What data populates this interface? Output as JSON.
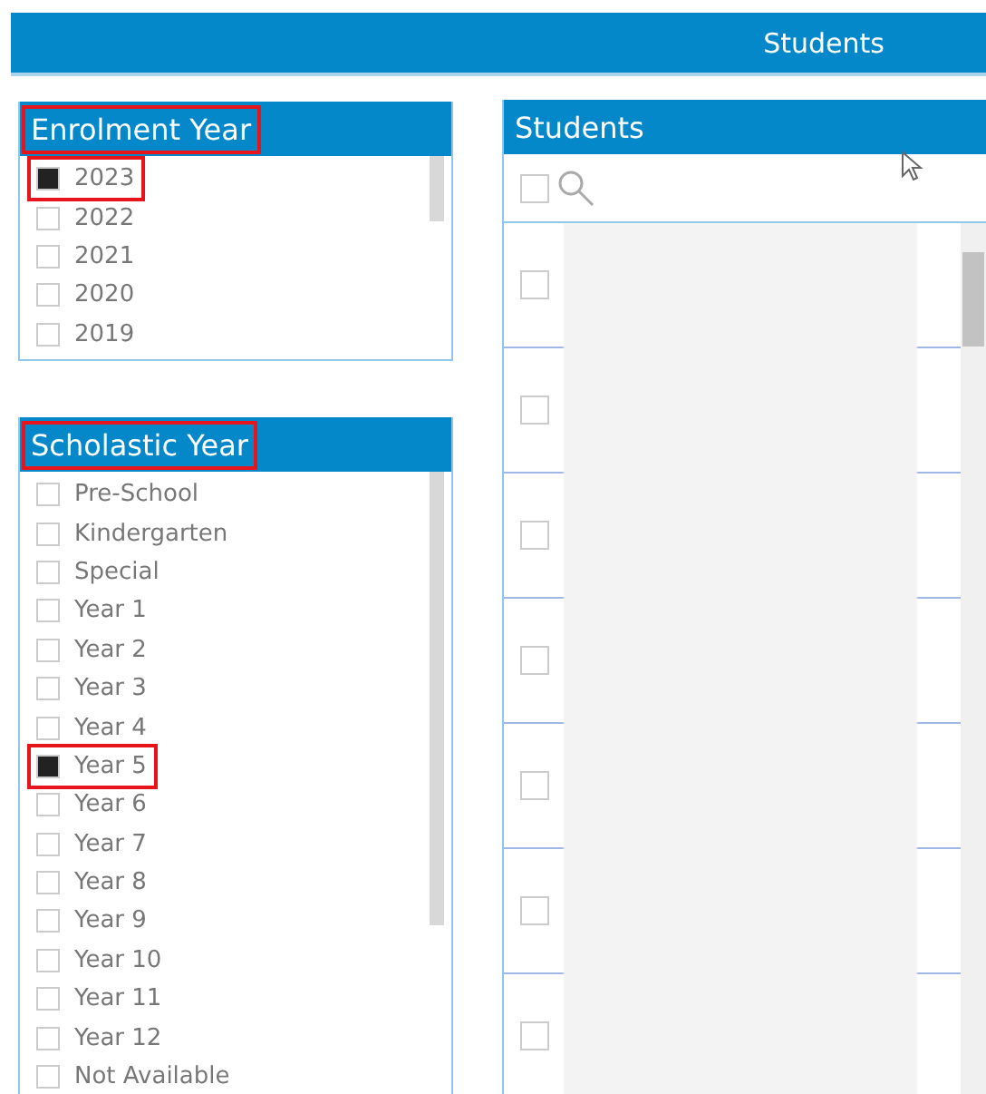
{
  "top_bar": {
    "title": "Students"
  },
  "enrolment_year": {
    "title": "Enrolment Year",
    "highlighted": true,
    "items": [
      {
        "label": "2023",
        "checked": true,
        "highlighted": true
      },
      {
        "label": "2022",
        "checked": false,
        "highlighted": false
      },
      {
        "label": "2021",
        "checked": false,
        "highlighted": false
      },
      {
        "label": "2020",
        "checked": false,
        "highlighted": false
      },
      {
        "label": "2019",
        "checked": false,
        "highlighted": false
      }
    ]
  },
  "scholastic_year": {
    "title": "Scholastic Year",
    "highlighted": true,
    "items": [
      {
        "label": "Pre-School",
        "checked": false,
        "highlighted": false
      },
      {
        "label": "Kindergarten",
        "checked": false,
        "highlighted": false
      },
      {
        "label": "Special",
        "checked": false,
        "highlighted": false
      },
      {
        "label": "Year 1",
        "checked": false,
        "highlighted": false
      },
      {
        "label": "Year 2",
        "checked": false,
        "highlighted": false
      },
      {
        "label": "Year 3",
        "checked": false,
        "highlighted": false
      },
      {
        "label": "Year 4",
        "checked": false,
        "highlighted": false
      },
      {
        "label": "Year 5",
        "checked": true,
        "highlighted": true
      },
      {
        "label": "Year 6",
        "checked": false,
        "highlighted": false
      },
      {
        "label": "Year 7",
        "checked": false,
        "highlighted": false
      },
      {
        "label": "Year 8",
        "checked": false,
        "highlighted": false
      },
      {
        "label": "Year 9",
        "checked": false,
        "highlighted": false
      },
      {
        "label": "Year 10",
        "checked": false,
        "highlighted": false
      },
      {
        "label": "Year 11",
        "checked": false,
        "highlighted": false
      },
      {
        "label": "Year 12",
        "checked": false,
        "highlighted": false
      },
      {
        "label": "Not Available",
        "checked": false,
        "highlighted": false
      }
    ]
  },
  "students": {
    "title": "Students",
    "select_all_checked": false,
    "rows": [
      {
        "checked": false
      },
      {
        "checked": false
      },
      {
        "checked": false
      },
      {
        "checked": false
      },
      {
        "checked": false
      },
      {
        "checked": false
      },
      {
        "checked": false
      }
    ]
  }
}
